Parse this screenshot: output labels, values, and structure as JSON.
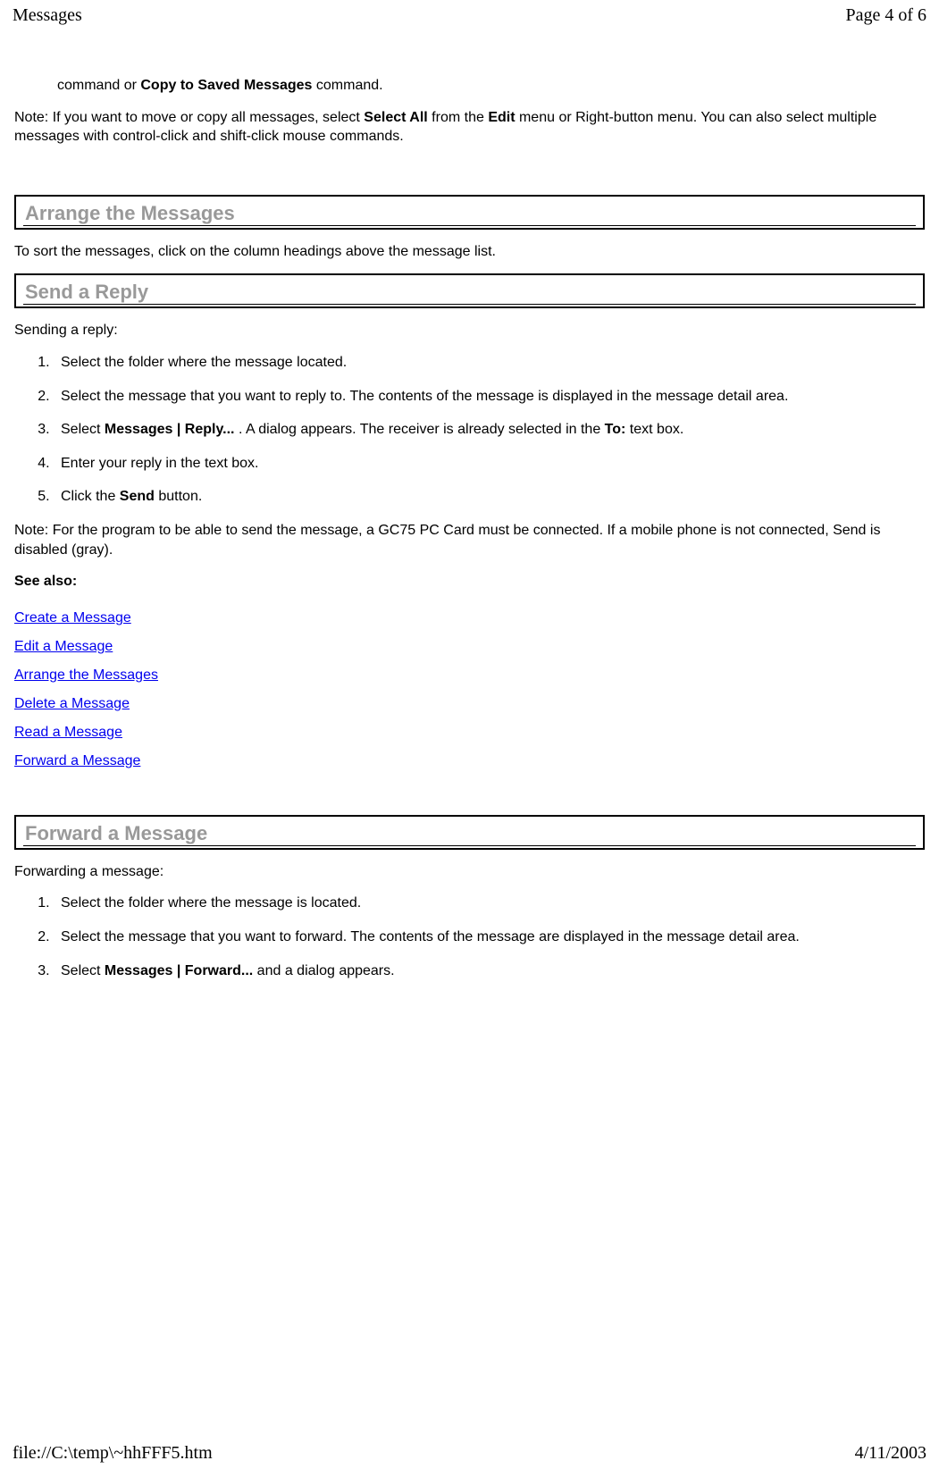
{
  "header": {
    "title": "Messages",
    "page_info": "Page 4 of 6"
  },
  "intro": {
    "line1_prefix": "command or ",
    "line1_bold": "Copy to Saved Messages",
    "line1_suffix": " command.",
    "note_prefix": "Note: If you want to move or copy all messages, select ",
    "note_bold1": "Select All",
    "note_mid1": " from the ",
    "note_bold2": "Edit",
    "note_suffix": " menu or Right-button menu. You can also select multiple messages with control-click and shift-click mouse commands."
  },
  "sections": {
    "arrange": {
      "title": "Arrange the Messages",
      "body": "To sort the messages, click on the column headings above the message list."
    },
    "reply": {
      "title": "Send a Reply",
      "intro": "Sending a reply:",
      "steps": {
        "s1": "Select the folder where the message located.",
        "s2": "Select the message that you want to reply to. The contents of the message is displayed in the message detail area.",
        "s3_pre": "Select ",
        "s3_bold1": "Messages | Reply...",
        "s3_mid": " . A dialog appears. The receiver is already selected in the ",
        "s3_bold2": "To:",
        "s3_post": " text box.",
        "s4": "Enter your reply in the text box.",
        "s5_pre": "Click the ",
        "s5_bold": "Send",
        "s5_post": " button."
      },
      "note": "Note: For the program to be able to send the message, a GC75 PC Card must be connected. If a mobile phone is not connected, Send is disabled (gray).",
      "see_also": "See also:",
      "links": [
        "Create a Message",
        "Edit a Message",
        "Arrange the Messages",
        "Delete a Message",
        "Read a Message",
        "Forward a Message"
      ]
    },
    "forward": {
      "title": "Forward a Message",
      "intro": "Forwarding a message:",
      "steps": {
        "s1": "Select the folder where the message is located.",
        "s2": "Select the message that you want to forward. The contents of the message are displayed in the message detail area.",
        "s3_pre": "Select ",
        "s3_bold": "Messages | Forward...",
        "s3_post": " and a dialog appears."
      }
    }
  },
  "footer": {
    "path": "file://C:\\temp\\~hhFFF5.htm",
    "date": "4/11/2003"
  }
}
